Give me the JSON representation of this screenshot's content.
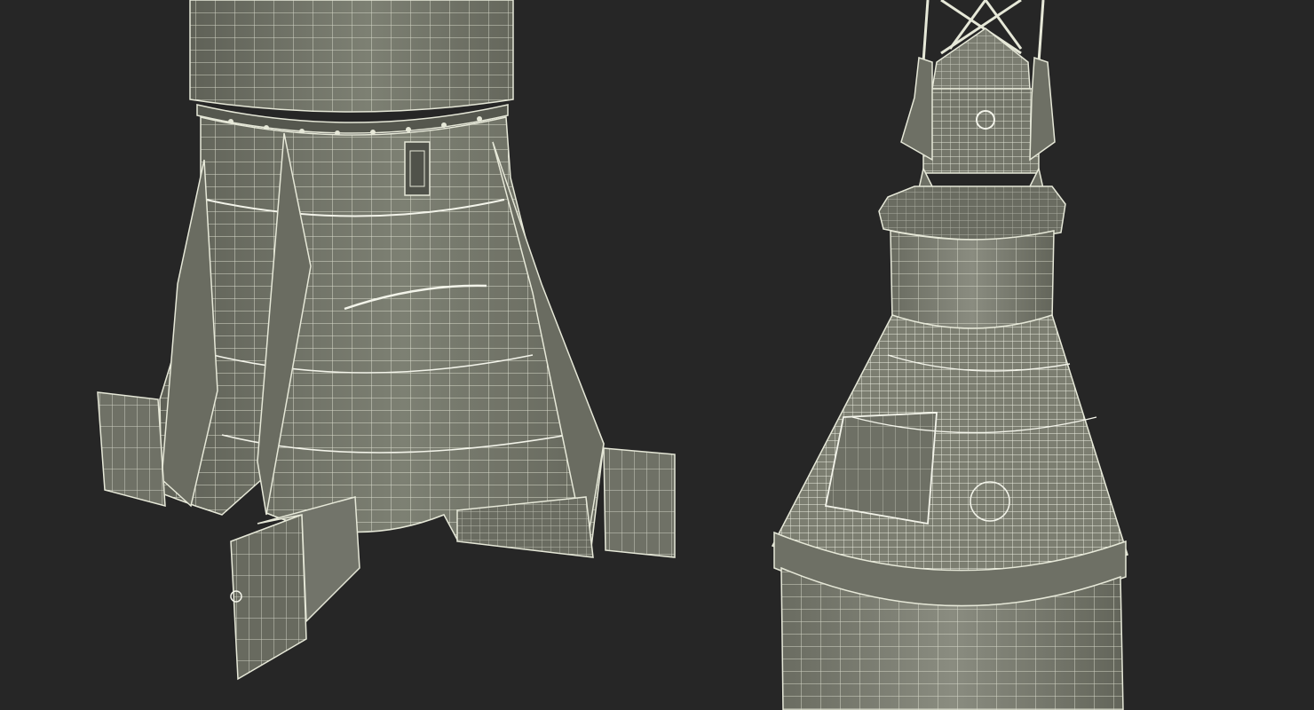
{
  "scene": {
    "background_color": "#262626",
    "mesh_fill_color": "#74766a",
    "mesh_wire_color": "#e6e8d8",
    "objects": [
      {
        "name": "rocket-booster-base",
        "description": ""
      },
      {
        "name": "launch-escape-tower-capsule",
        "description": ""
      }
    ]
  }
}
